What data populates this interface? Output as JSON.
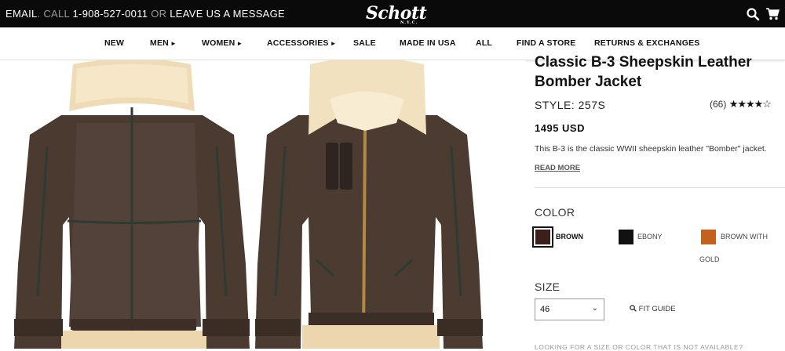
{
  "topbar": {
    "email": "EMAIL",
    "call_label": "CALL",
    "phone": "1-908-527-0011",
    "or_text": "OR",
    "message": "LEAVE US A MESSAGE",
    "logo": "Schott",
    "logo_sub": "N.Y.C.",
    "search_icon": "search-icon",
    "cart_icon": "cart-icon"
  },
  "nav": {
    "items": [
      {
        "label": "NEW",
        "arrow": ""
      },
      {
        "label": "MEN",
        "arrow": "►"
      },
      {
        "label": "WOMEN",
        "arrow": "►"
      },
      {
        "label": "ACCESSORIES",
        "arrow": "►"
      },
      {
        "label": "SALE",
        "arrow": ""
      },
      {
        "label": "MADE IN USA",
        "arrow": ""
      },
      {
        "label": "ALL",
        "arrow": ""
      },
      {
        "label": "FIND A STORE",
        "arrow": ""
      },
      {
        "label": "RETURNS & EXCHANGES",
        "arrow": ""
      }
    ]
  },
  "product": {
    "title_line1": "Classic B-3 Sheepskin Leather",
    "title_line2": "Bomber Jacket",
    "style": "STYLE: 257S",
    "review_count": "(66)",
    "stars": "★★★★☆",
    "price": "1495 USD",
    "description": "This B-3 is the classic WWII sheepskin leather \"Bomber\" jacket.",
    "read_more": "READ MORE"
  },
  "color": {
    "label": "COLOR",
    "options": [
      {
        "name": "BROWN",
        "hex": "#3a1f1a"
      },
      {
        "name": "EBONY",
        "hex": "#111111"
      },
      {
        "name": "BROWN WITH",
        "name2": "GOLD",
        "hex": "#c4611c"
      }
    ]
  },
  "size": {
    "label": "SIZE",
    "selected": "46",
    "fit_guide": "FIT GUIDE"
  },
  "footer_note": "LOOKING FOR A SIZE OR COLOR THAT IS NOT AVAILABLE?"
}
